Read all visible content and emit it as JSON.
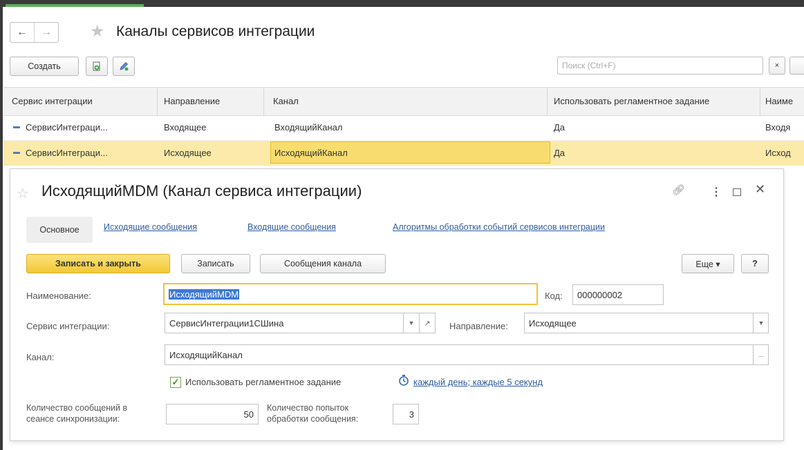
{
  "window": {
    "title": "Каналы сервисов интеграции"
  },
  "toolbar": {
    "create_label": "Создать",
    "search_placeholder": "Поиск (Ctrl+F)",
    "search_clear": "×"
  },
  "table": {
    "columns": [
      "Сервис интеграции",
      "Направление",
      "Канал",
      "Использовать регламентное задание",
      "Наиме"
    ],
    "rows": [
      {
        "service": "СервисИнтеграци...",
        "direction": "Входящее",
        "channel": "ВходящийКанал",
        "use_task": "Да",
        "name": "Входя"
      },
      {
        "service": "СервисИнтеграци...",
        "direction": "Исходящее",
        "channel": "ИсходящийКанал",
        "use_task": "Да",
        "name": "Исход"
      }
    ]
  },
  "form": {
    "title": "ИсходящийMDM (Канал сервиса интеграции)",
    "tabs": [
      "Основное",
      "Исходящие сообщения",
      "Входящие сообщения",
      "Алгоритмы обработки событий сервисов интеграции"
    ],
    "buttons": {
      "save_close": "Записать и закрыть",
      "save": "Записать",
      "messages": "Сообщения канала",
      "more": "Еще ▾",
      "help": "?"
    },
    "fields": {
      "name_label": "Наименование:",
      "name_value": "ИсходящийMDM",
      "code_label": "Код:",
      "code_value": "000000002",
      "service_label": "Сервис интеграции:",
      "service_value": "СервисИнтеграции1СШина",
      "direction_label": "Направление:",
      "direction_value": "Исходящее",
      "channel_label": "Канал:",
      "channel_value": "ИсходящийКанал",
      "use_task_label": "Использовать регламентное задание",
      "schedule_link": "каждый день; каждые 5 секунд",
      "msg_count_label_1": "Количество сообщений в",
      "msg_count_label_2": "сеансе синхронизации:",
      "msg_count_value": "50",
      "attempts_label_1": "Количество попыток",
      "attempts_label_2": "обработки сообщения:",
      "attempts_value": "3"
    }
  },
  "colors": {
    "accent_yellow": "#f2c936",
    "selected_row": "#fbeaa9",
    "link_blue": "#2f5c9e"
  }
}
